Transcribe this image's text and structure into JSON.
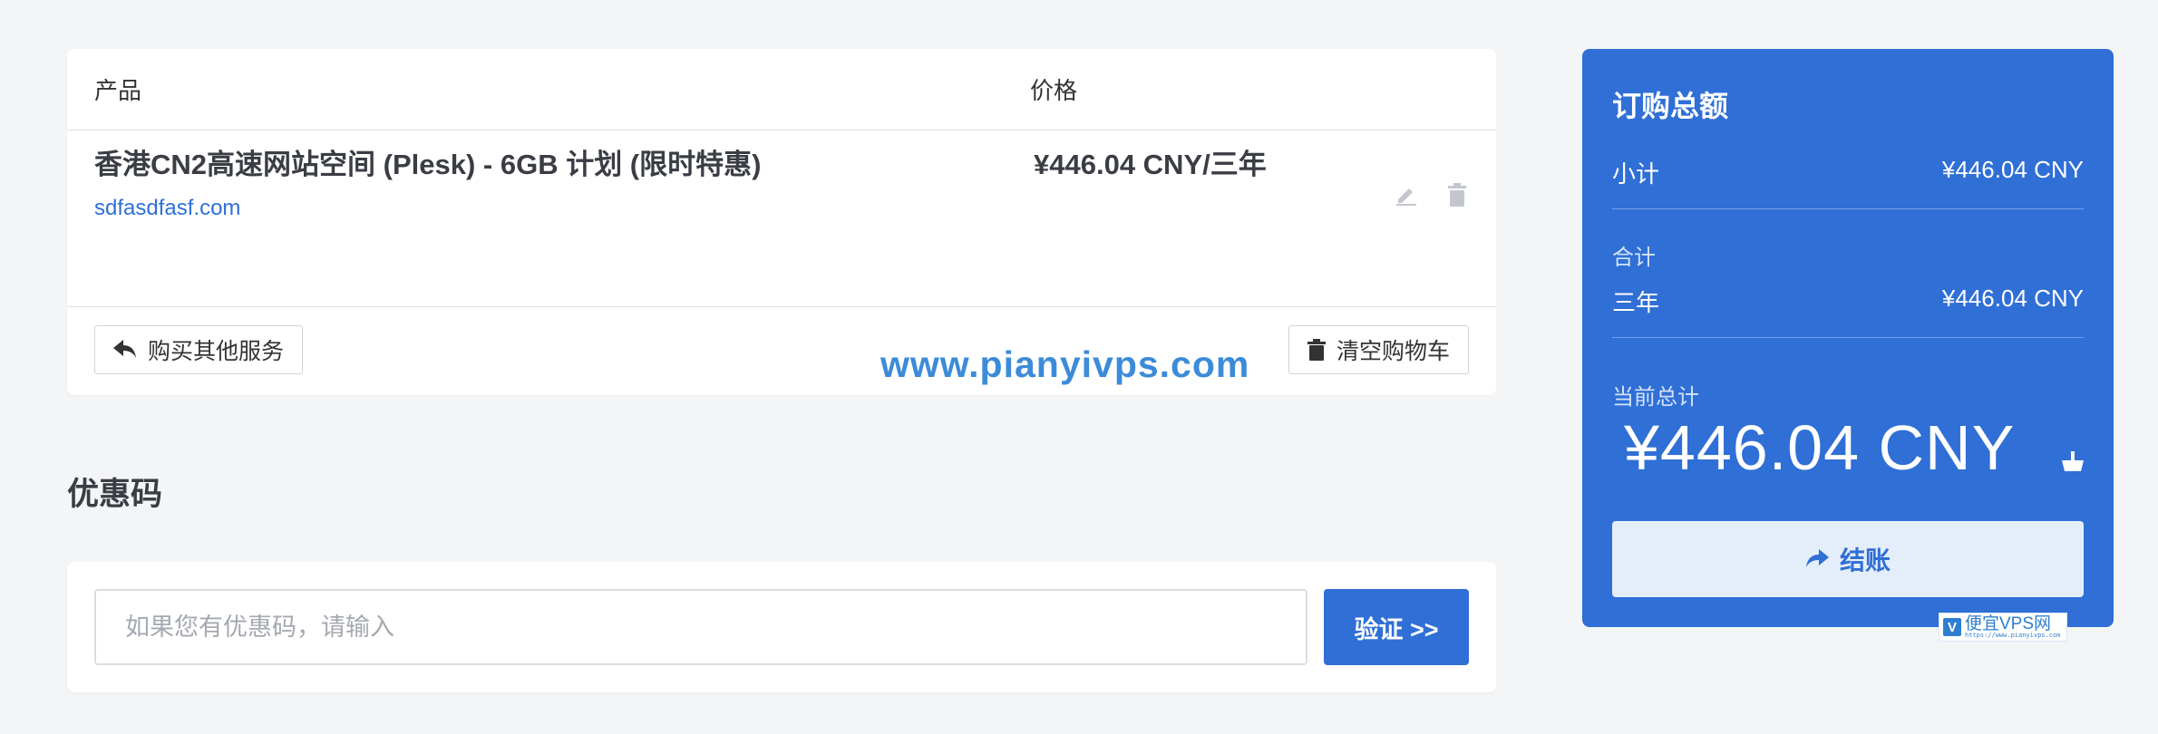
{
  "cart": {
    "headers": {
      "product": "产品",
      "price": "价格"
    },
    "item": {
      "name": "香港CN2高速网站空间 (Plesk) - 6GB 计划 (限时特惠)",
      "domain": "sdfasdfasf.com",
      "price": "¥446.04 CNY/三年",
      "icons": {
        "edit": "pencil-icon",
        "delete": "trash-icon"
      }
    },
    "actions": {
      "continue_shopping": "购买其他服务",
      "empty_cart": "清空购物车"
    }
  },
  "watermark": "www.pianyivps.com",
  "coupon": {
    "title": "优惠码",
    "placeholder": "如果您有优惠码，请输入",
    "verify_label": "验证 >>"
  },
  "summary": {
    "title": "订购总额",
    "subtotal_label": "小计",
    "subtotal_value": "¥446.04 CNY",
    "totals_label": "合计",
    "cycle_label": "三年",
    "cycle_value": "¥446.04 CNY",
    "due_label": "当前总计",
    "grand_total": "¥446.04 CNY",
    "checkout_label": "结账"
  },
  "logo": {
    "letter": "V",
    "name": "便宜VPS网",
    "url": "https://www.pianyivps.com"
  },
  "colors": {
    "accent": "#2f6fd6",
    "background": "#f4f5f7",
    "watermark": "#3c8bd9"
  }
}
